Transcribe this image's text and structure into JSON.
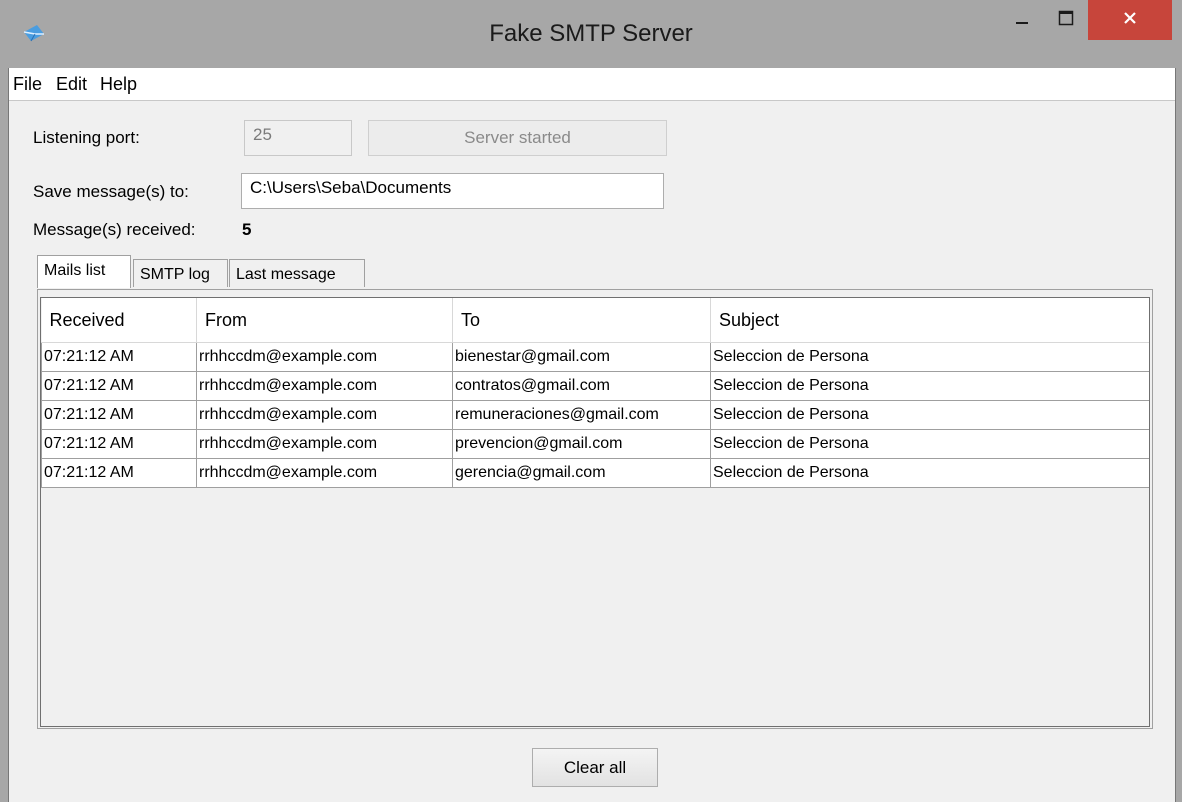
{
  "window": {
    "title": "Fake SMTP Server",
    "app_icon": "envelope-icon"
  },
  "titlebar_buttons": {
    "minimize": "minimize-icon",
    "maximize": "maximize-icon",
    "close": "close-icon",
    "close_color": "#c7453b"
  },
  "menu": [
    "File",
    "Edit",
    "Help"
  ],
  "form": {
    "port_label": "Listening port:",
    "port_value": "25",
    "server_button": "Server started",
    "save_label": "Save message(s) to:",
    "save_value": "C:\\Users\\Seba\\Documents",
    "received_label": "Message(s) received:",
    "received_count": "5"
  },
  "tabs": [
    {
      "label": "Mails list",
      "active": true
    },
    {
      "label": "SMTP log",
      "active": false
    },
    {
      "label": "Last message",
      "active": false
    }
  ],
  "mails": {
    "columns": [
      "Received",
      "From",
      "To",
      "Subject"
    ],
    "rows": [
      [
        "07:21:12 AM",
        "rrhhccdm@example.com",
        "bienestar@gmail.com",
        "Seleccion de Persona"
      ],
      [
        "07:21:12 AM",
        "rrhhccdm@example.com",
        "contratos@gmail.com",
        "Seleccion de Persona"
      ],
      [
        "07:21:12 AM",
        "rrhhccdm@example.com",
        "remuneraciones@gmail.com",
        "Seleccion de Persona"
      ],
      [
        "07:21:12 AM",
        "rrhhccdm@example.com",
        "prevencion@gmail.com",
        "Seleccion de Persona"
      ],
      [
        "07:21:12 AM",
        "rrhhccdm@example.com",
        "gerencia@gmail.com",
        "Seleccion de Persona"
      ]
    ]
  },
  "clear_button": "Clear all"
}
